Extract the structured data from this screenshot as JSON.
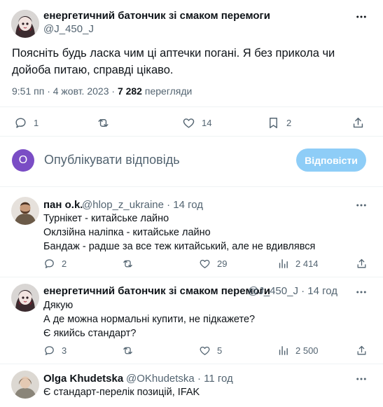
{
  "main_tweet": {
    "author_name": "енергетичний батончик зі смаком перемоги",
    "author_handle": "@J_450_J",
    "text": "Поясніть будь ласка чим ці аптечки погані. Я без прикола чи дойоба питаю, справді цікаво.",
    "time": "9:51 пп · 4 жовт. 2023 · ",
    "views_count": "7 282",
    "views_label": " перегляди",
    "actions": {
      "replies": "1",
      "retweets": "",
      "likes": "14",
      "bookmarks": "2"
    }
  },
  "reply_box": {
    "avatar_letter": "O",
    "placeholder": "Опублікувати відповідь",
    "button_label": "Відповісти"
  },
  "replies": [
    {
      "author_name": "пан o.k.",
      "author_handle": "@hlop_z_ukraine · 14 год",
      "lines": [
        "Турнікет - китайське лайно",
        "Оклзійна наліпка - китайське лайно",
        "Бандаж - радше за все теж китайський, але не вдивлявся"
      ],
      "actions": {
        "replies": "2",
        "retweets": "",
        "likes": "29",
        "views": "2 414"
      }
    },
    {
      "author_name": "енергетичний батончик зі смаком перемоги",
      "author_handle": "@J_450_J · 14 год",
      "lines": [
        "Дякую",
        "А де можна нормальні купити, не підкажете?",
        "Є якийсь стандарт?"
      ],
      "actions": {
        "replies": "3",
        "retweets": "",
        "likes": "5",
        "views": "2 500"
      }
    },
    {
      "author_name": "Olga Khudetska",
      "author_handle": "@OKhudetska · 11 год",
      "lines": [
        "Є стандарт-перелік позицій, IFAK"
      ]
    }
  ],
  "icons": {
    "reply": "reply-icon",
    "retweet": "retweet-icon",
    "like": "heart-icon",
    "bookmark": "bookmark-icon",
    "share": "share-icon",
    "views": "views-chart-icon",
    "more": "more-icon"
  },
  "colors": {
    "text": "#0f1419",
    "secondary": "#536471",
    "reply_button": "#8ecdf7",
    "reply_avatar": "#7a4dc5",
    "divider": "#eff3f4"
  }
}
